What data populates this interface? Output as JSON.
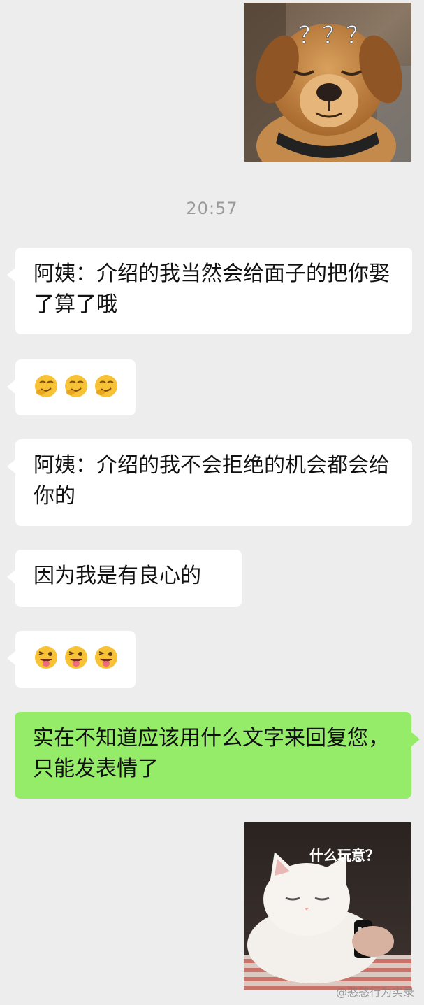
{
  "timestamp": "20:57",
  "messages": [
    {
      "side": "right",
      "type": "sticker",
      "name": "confused-dog-sticker",
      "overlay_text": "？？？"
    },
    {
      "side": "left",
      "type": "text",
      "text": "阿姨：介绍的我当然会给面子的把你娶了算了哦"
    },
    {
      "side": "left",
      "type": "emoji",
      "emoji_names": [
        "smirk-emoji",
        "smirk-emoji",
        "smirk-emoji"
      ]
    },
    {
      "side": "left",
      "type": "text",
      "text": "阿姨：介绍的我不会拒绝的机会都会给你的"
    },
    {
      "side": "left",
      "type": "text",
      "text": "因为我是有良心的"
    },
    {
      "side": "left",
      "type": "emoji",
      "emoji_names": [
        "winking-tongue-emoji",
        "winking-tongue-emoji",
        "winking-tongue-emoji"
      ]
    },
    {
      "side": "right",
      "type": "text",
      "text": "实在不知道应该用什么文字来回复您，只能发表情了"
    },
    {
      "side": "right",
      "type": "sticker",
      "name": "squinting-cat-sticker",
      "overlay_text": "什么玩意？"
    }
  ],
  "watermark": "@憨憨行为实录"
}
